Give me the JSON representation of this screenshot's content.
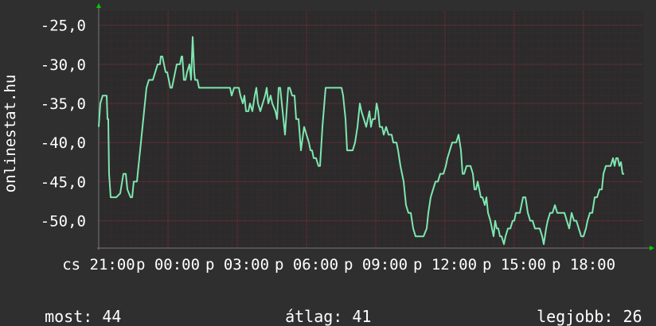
{
  "chart_data": {
    "type": "line",
    "ylabel": "onlinestat.hu",
    "ylim": [
      -53.5,
      -23.2
    ],
    "xlim": [
      0,
      684
    ],
    "ytick_labels": [
      "-25,0",
      "-30,0",
      "-35,0",
      "-40,0",
      "-45,0",
      "-50,0"
    ],
    "ytick_values": [
      -25,
      -30,
      -35,
      -40,
      -45,
      -50
    ],
    "xtick_labels": [
      "cs 21:00",
      "p 00:00",
      "p 03:00",
      "p 06:00",
      "p 09:00",
      "p 12:00",
      "p 15:00",
      "p 18:00"
    ],
    "xtick_values": [
      0,
      87,
      174,
      261,
      348,
      435,
      522,
      609
    ],
    "grid": true,
    "colors": {
      "line": "#7ee6b0",
      "grid": "#8a2a3a",
      "axis": "#00cc00",
      "background": "#2f2f2f",
      "plot_bg": "#2b2b2b"
    },
    "series": [
      {
        "values": [
          [
            0,
            -38
          ],
          [
            2,
            -35
          ],
          [
            5,
            -34
          ],
          [
            10,
            -34
          ],
          [
            11,
            -37
          ],
          [
            12,
            -37
          ],
          [
            13,
            -44
          ],
          [
            15,
            -47
          ],
          [
            18,
            -47
          ],
          [
            22,
            -47
          ],
          [
            27,
            -46.5
          ],
          [
            31,
            -44
          ],
          [
            34,
            -44
          ],
          [
            36,
            -46
          ],
          [
            40,
            -47
          ],
          [
            42,
            -47
          ],
          [
            44,
            -45
          ],
          [
            48,
            -45
          ],
          [
            52,
            -41
          ],
          [
            55,
            -38
          ],
          [
            57,
            -36
          ],
          [
            60,
            -33
          ],
          [
            63,
            -32
          ],
          [
            68,
            -32
          ],
          [
            71,
            -31
          ],
          [
            74,
            -30
          ],
          [
            77,
            -30
          ],
          [
            78,
            -29
          ],
          [
            80,
            -29
          ],
          [
            82,
            -30
          ],
          [
            84,
            -31
          ],
          [
            86,
            -31
          ],
          [
            88,
            -32
          ],
          [
            90,
            -33
          ],
          [
            92,
            -33
          ],
          [
            94,
            -32
          ],
          [
            96,
            -31
          ],
          [
            98,
            -30
          ],
          [
            102,
            -30
          ],
          [
            104,
            -29
          ],
          [
            105,
            -29
          ],
          [
            107,
            -32
          ],
          [
            109,
            -32
          ],
          [
            111,
            -31
          ],
          [
            114,
            -30
          ],
          [
            116,
            -32
          ],
          [
            118,
            -26.5
          ],
          [
            120,
            -31
          ],
          [
            121,
            -32
          ],
          [
            124,
            -32
          ],
          [
            126,
            -33
          ],
          [
            130,
            -33
          ],
          [
            135,
            -33
          ],
          [
            140,
            -33
          ],
          [
            145,
            -33
          ],
          [
            150,
            -33
          ],
          [
            155,
            -33
          ],
          [
            160,
            -33
          ],
          [
            165,
            -33
          ],
          [
            167,
            -34
          ],
          [
            170,
            -33
          ],
          [
            173,
            -33
          ],
          [
            176,
            -33
          ],
          [
            178,
            -34
          ],
          [
            181,
            -35
          ],
          [
            183,
            -34
          ],
          [
            185,
            -36
          ],
          [
            188,
            -36
          ],
          [
            190,
            -35
          ],
          [
            193,
            -36
          ],
          [
            196,
            -34
          ],
          [
            198,
            -33
          ],
          [
            200,
            -35
          ],
          [
            203,
            -36
          ],
          [
            206,
            -35
          ],
          [
            209,
            -34
          ],
          [
            211,
            -33
          ],
          [
            213,
            -35
          ],
          [
            216,
            -34
          ],
          [
            218,
            -35
          ],
          [
            222,
            -36
          ],
          [
            224,
            -37
          ],
          [
            226,
            -33
          ],
          [
            228,
            -33
          ],
          [
            230,
            -35
          ],
          [
            234,
            -39
          ],
          [
            236,
            -36
          ],
          [
            238,
            -33
          ],
          [
            240,
            -33
          ],
          [
            243,
            -34
          ],
          [
            246,
            -34
          ],
          [
            248,
            -37
          ],
          [
            251,
            -37
          ],
          [
            254,
            -41
          ],
          [
            258,
            -38
          ],
          [
            261,
            -39
          ],
          [
            264,
            -40
          ],
          [
            266,
            -41
          ],
          [
            268,
            -41
          ],
          [
            270,
            -42
          ],
          [
            273,
            -42
          ],
          [
            276,
            -43
          ],
          [
            278,
            -43
          ],
          [
            281,
            -38
          ],
          [
            285,
            -33
          ],
          [
            290,
            -33
          ],
          [
            295,
            -33
          ],
          [
            300,
            -33
          ],
          [
            305,
            -33
          ],
          [
            307,
            -34
          ],
          [
            310,
            -37
          ],
          [
            312,
            -41
          ],
          [
            316,
            -41
          ],
          [
            319,
            -41
          ],
          [
            322,
            -40
          ],
          [
            325,
            -38
          ],
          [
            328,
            -35
          ],
          [
            330,
            -36
          ],
          [
            333,
            -37
          ],
          [
            336,
            -38
          ],
          [
            338,
            -37
          ],
          [
            340,
            -36
          ],
          [
            342,
            -38
          ],
          [
            344,
            -37
          ],
          [
            347,
            -37
          ],
          [
            349,
            -35
          ],
          [
            351,
            -36
          ],
          [
            353,
            -38
          ],
          [
            356,
            -38
          ],
          [
            358,
            -39
          ],
          [
            361,
            -38
          ],
          [
            364,
            -39
          ],
          [
            368,
            -39
          ],
          [
            370,
            -40
          ],
          [
            374,
            -40
          ],
          [
            376,
            -41
          ],
          [
            379,
            -43
          ],
          [
            383,
            -45
          ],
          [
            386,
            -48
          ],
          [
            389,
            -49
          ],
          [
            392,
            -49
          ],
          [
            395,
            -51
          ],
          [
            398,
            -52
          ],
          [
            403,
            -52
          ],
          [
            408,
            -52
          ],
          [
            412,
            -51
          ],
          [
            414,
            -49
          ],
          [
            417,
            -47
          ],
          [
            420,
            -46
          ],
          [
            423,
            -45
          ],
          [
            426,
            -45
          ],
          [
            429,
            -44
          ],
          [
            433,
            -44
          ],
          [
            436,
            -43
          ],
          [
            438,
            -42
          ],
          [
            441,
            -41
          ],
          [
            444,
            -40
          ],
          [
            447,
            -40
          ],
          [
            449,
            -40
          ],
          [
            452,
            -39
          ],
          [
            455,
            -41
          ],
          [
            457,
            -44
          ],
          [
            459,
            -44
          ],
          [
            462,
            -43
          ],
          [
            465,
            -43
          ],
          [
            467,
            -43
          ],
          [
            470,
            -44
          ],
          [
            472,
            -46
          ],
          [
            474,
            -46
          ],
          [
            476,
            -45
          ],
          [
            478,
            -46
          ],
          [
            480,
            -47
          ],
          [
            482,
            -47
          ],
          [
            485,
            -48
          ],
          [
            487,
            -47
          ],
          [
            489,
            -49
          ],
          [
            492,
            -50
          ],
          [
            494,
            -51
          ],
          [
            496,
            -52
          ],
          [
            498,
            -50
          ],
          [
            500,
            -51
          ],
          [
            502,
            -51
          ],
          [
            504,
            -52
          ],
          [
            506,
            -52
          ],
          [
            509,
            -53
          ],
          [
            511,
            -52
          ],
          [
            514,
            -51
          ],
          [
            517,
            -51
          ],
          [
            520,
            -50
          ],
          [
            522,
            -50
          ],
          [
            524,
            -49
          ],
          [
            527,
            -49
          ],
          [
            529,
            -49
          ],
          [
            531,
            -48
          ],
          [
            533,
            -47
          ],
          [
            536,
            -47
          ],
          [
            539,
            -49
          ],
          [
            542,
            -50
          ],
          [
            545,
            -50
          ],
          [
            548,
            -51
          ],
          [
            551,
            -51
          ],
          [
            554,
            -51
          ],
          [
            557,
            -52
          ],
          [
            559,
            -53
          ],
          [
            562,
            -51
          ],
          [
            564,
            -50
          ],
          [
            567,
            -49
          ],
          [
            570,
            -49
          ],
          [
            573,
            -48
          ],
          [
            576,
            -49
          ],
          [
            579,
            -49
          ],
          [
            582,
            -49
          ],
          [
            585,
            -49
          ],
          [
            588,
            -50
          ],
          [
            591,
            -51
          ],
          [
            594,
            -49
          ],
          [
            597,
            -50
          ],
          [
            600,
            -50
          ],
          [
            603,
            -51
          ],
          [
            606,
            -52
          ],
          [
            609,
            -52
          ],
          [
            612,
            -51
          ],
          [
            614,
            -50
          ],
          [
            617,
            -49
          ],
          [
            620,
            -49
          ],
          [
            623,
            -47
          ],
          [
            626,
            -47
          ],
          [
            629,
            -46
          ],
          [
            632,
            -46
          ],
          [
            634,
            -44
          ],
          [
            637,
            -43
          ],
          [
            640,
            -43
          ],
          [
            643,
            -43
          ],
          [
            646,
            -42
          ],
          [
            648,
            -43
          ],
          [
            650,
            -42
          ],
          [
            652,
            -42
          ],
          [
            654,
            -43
          ],
          [
            656,
            -42.5
          ],
          [
            658,
            -44
          ],
          [
            660,
            -44
          ]
        ]
      }
    ]
  },
  "stats": {
    "current_label": "most:",
    "current_value": "44",
    "average_label": "átlag:",
    "average_value": "41",
    "best_label": "legjobb:",
    "best_value": "26"
  }
}
